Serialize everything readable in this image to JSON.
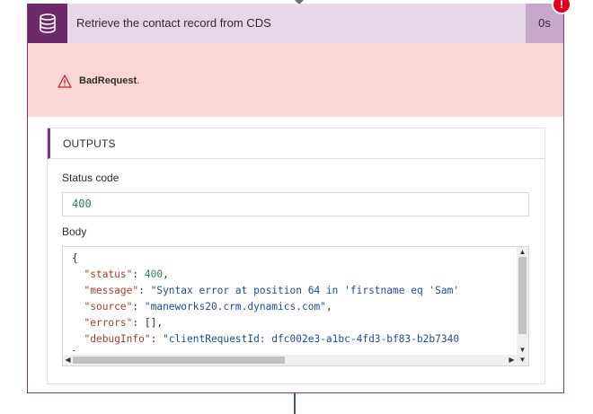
{
  "action": {
    "title": "Retrieve the contact record from CDS",
    "duration": "0s",
    "icon": "database-icon",
    "status_badge": "!",
    "accent_color": "#6c2a6a"
  },
  "error": {
    "icon": "warning-triangle-icon",
    "message": "BadRequest",
    "suffix": ".",
    "background_color": "#fbd7d3"
  },
  "outputs": {
    "section_title": "OUTPUTS",
    "status_code_label": "Status code",
    "status_code_value": "400",
    "body_label": "Body",
    "body_lines": {
      "open_brace": "{",
      "status_key": "\"status\"",
      "status_value": "400",
      "message_key": "\"message\"",
      "message_value": "\"Syntax error at position 64 in 'firstname eq 'Sam'",
      "source_key": "\"source\"",
      "source_value": "\"maneworks20.crm.dynamics.com\"",
      "errors_key": "\"errors\"",
      "errors_value": "[]",
      "debug_key": "\"debugInfo\"",
      "debug_value": "\"clientRequestId: dfc002e3-a1bc-4fd3-bf83-b2b7340",
      "close_brace": "}"
    }
  }
}
